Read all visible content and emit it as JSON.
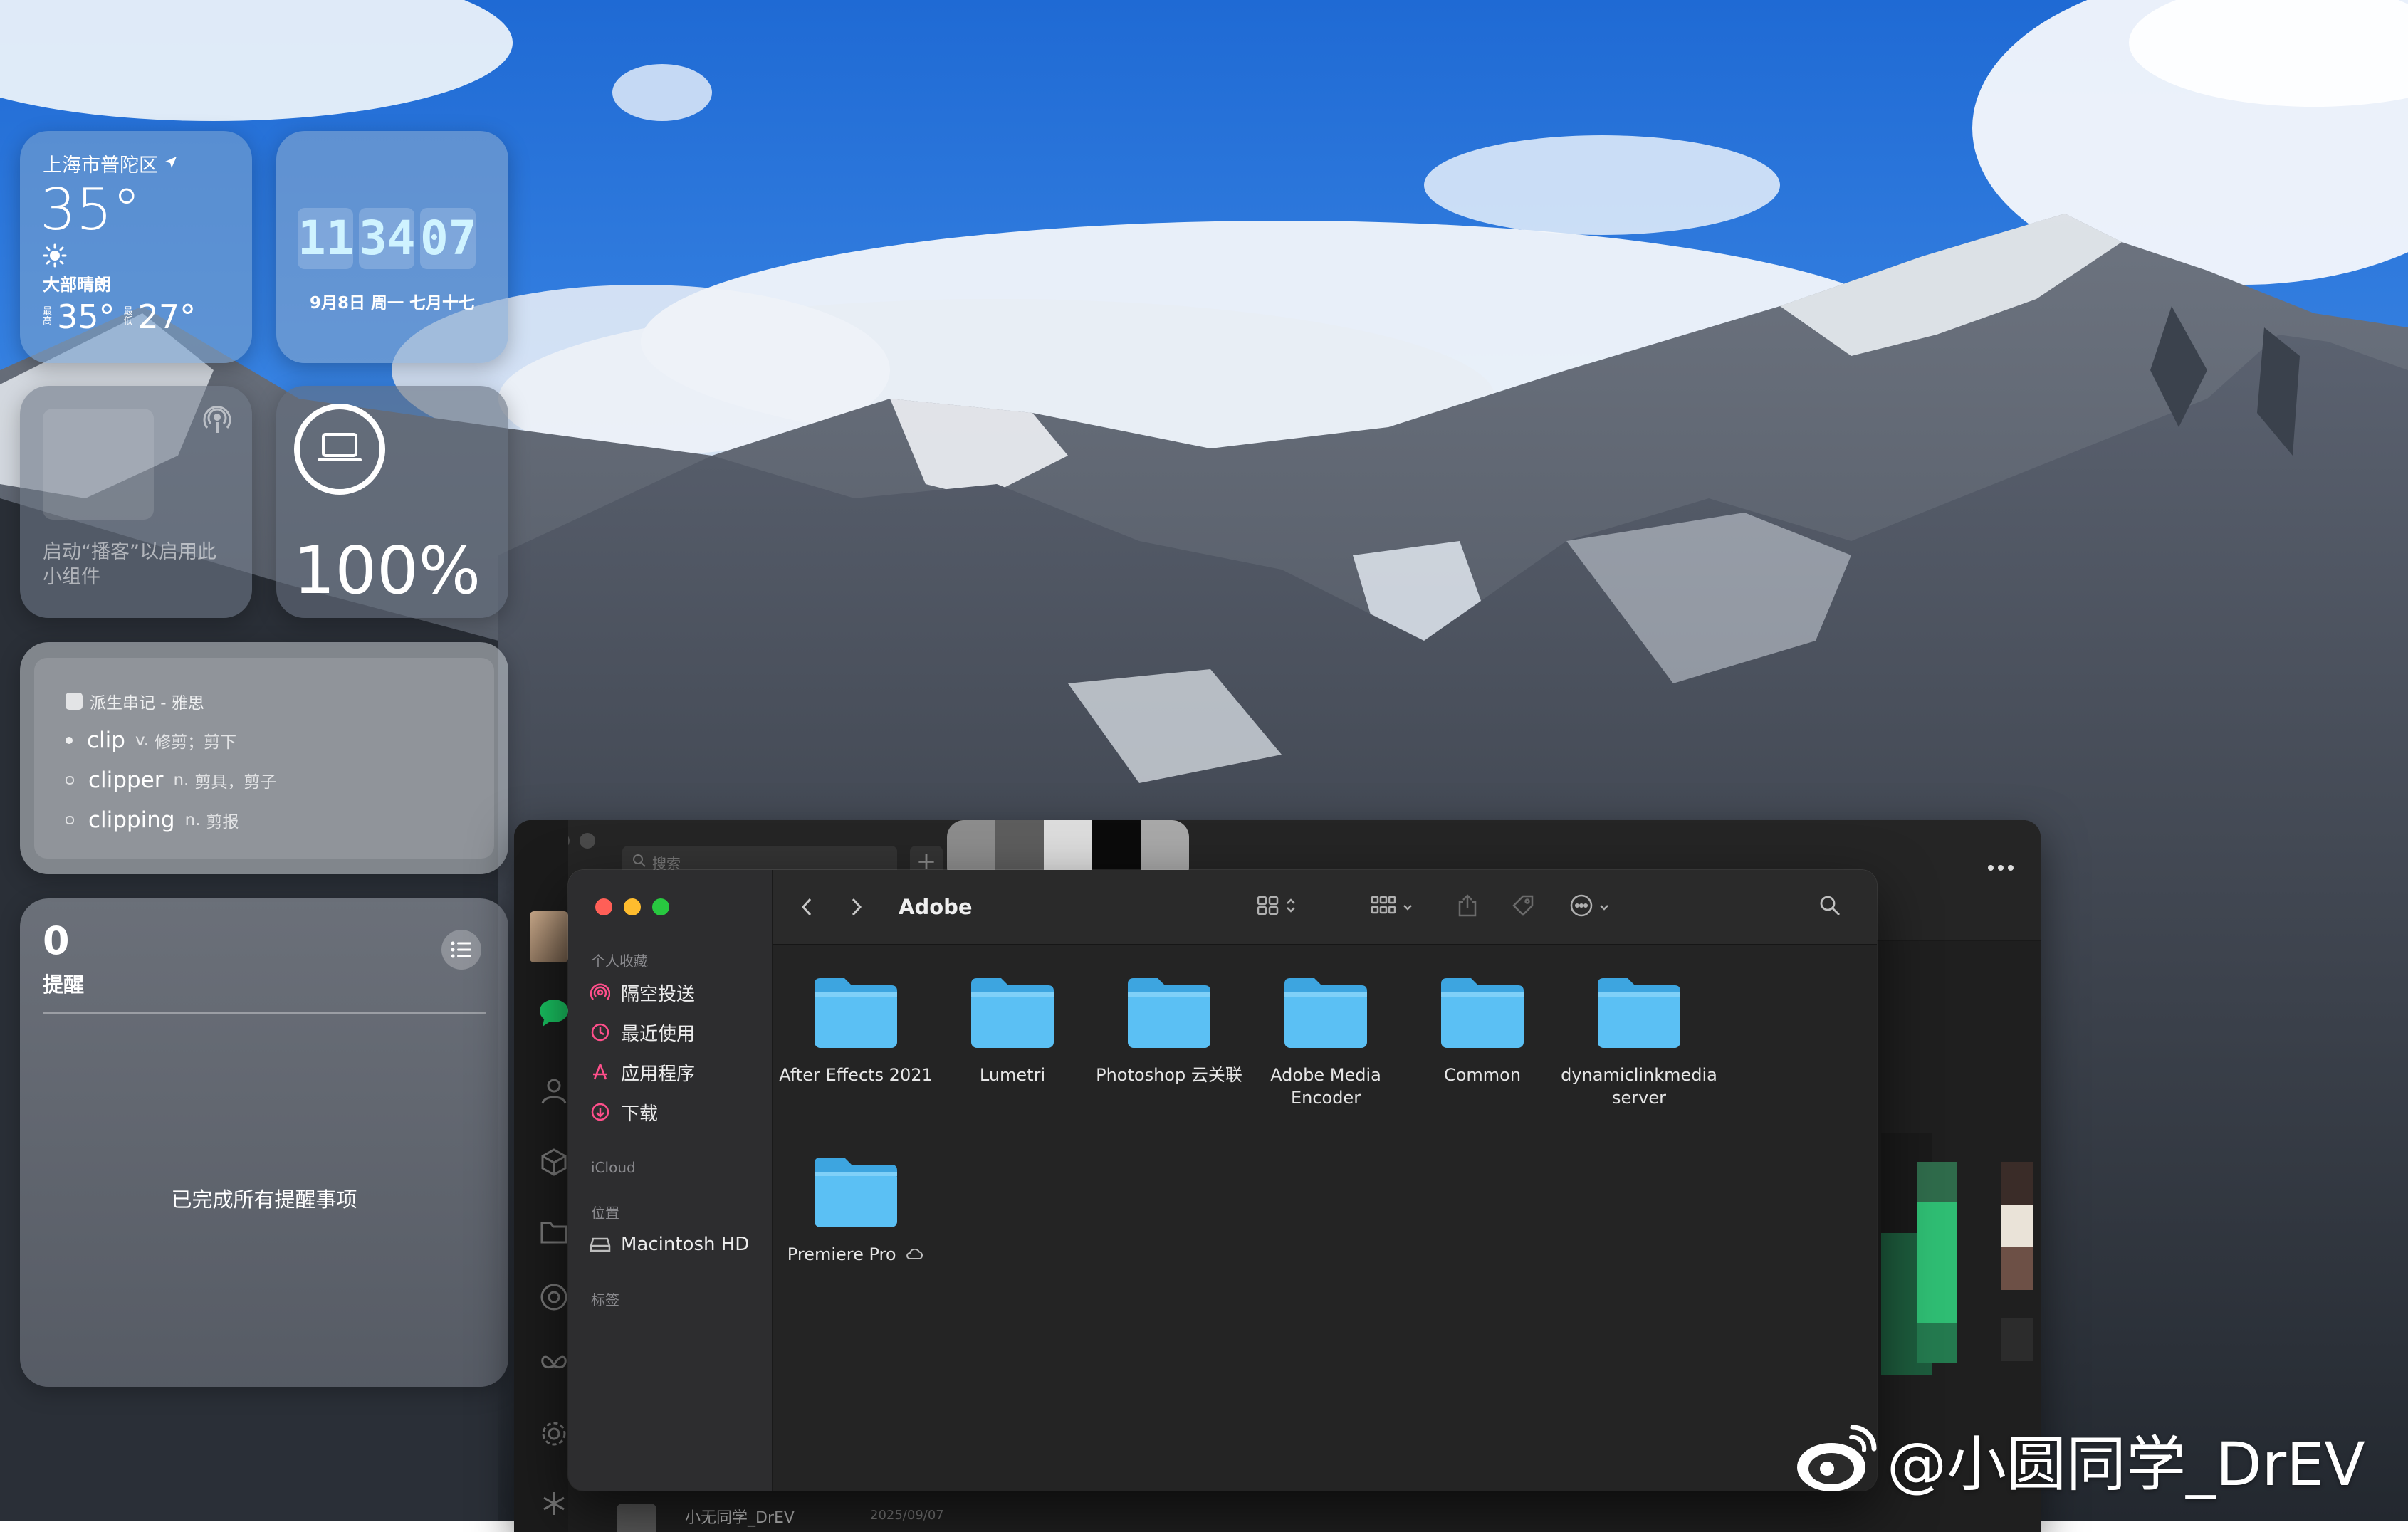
{
  "weather": {
    "location": "上海市普陀区",
    "temperature": "35°",
    "condition": "大部晴朗",
    "high_label": "最高",
    "high": "35°",
    "low_label": "最低",
    "low": "27°"
  },
  "clock": {
    "hour": "11",
    "minute": "34",
    "second": "07",
    "date": "9月8日 周一 七月十七"
  },
  "podcast": {
    "message": "启动“播客”以启用此小组件"
  },
  "battery": {
    "percent": "100%"
  },
  "dictionary": {
    "source": "派生串记 - 雅思",
    "entries": [
      {
        "word": "clip",
        "pos": "v.",
        "meaning": "修剪；剪下"
      },
      {
        "word": "clipper",
        "pos": "n.",
        "meaning": "剪具，剪子"
      },
      {
        "word": "clipping",
        "pos": "n.",
        "meaning": "剪报"
      }
    ]
  },
  "reminders": {
    "count": "0",
    "title": "提醒",
    "empty": "已完成所有提醒事项"
  },
  "background_app": {
    "search_placeholder": "搜索",
    "add": "+",
    "bottom_name": "小无同学_DrEV",
    "bottom_date": "2025/09/07"
  },
  "finder": {
    "title": "Adobe",
    "sidebar": {
      "favorites_header": "个人收藏",
      "favorites": [
        "隔空投送",
        "最近使用",
        "应用程序",
        "下载"
      ],
      "icloud_header": "iCloud",
      "locations_header": "位置",
      "locations": [
        "Macintosh HD"
      ],
      "tags_header": "标签"
    },
    "folders": [
      {
        "name": "After Effects 2021"
      },
      {
        "name": "Lumetri"
      },
      {
        "name": "Photoshop 云关联"
      },
      {
        "name": "Adobe Media Encoder"
      },
      {
        "name": "Common"
      },
      {
        "name": "dynamiclinkmedia server"
      },
      {
        "name": "Premiere Pro",
        "cloud": true
      }
    ]
  },
  "watermark": "@小圆同学_DrEV",
  "colors": {
    "folder": "#5bc0f4",
    "folder_tab": "#3da5e0",
    "close": "#ff5f57",
    "minimize": "#febc2e",
    "zoom": "#28c840",
    "accent_pink": "#ff4f8b"
  }
}
